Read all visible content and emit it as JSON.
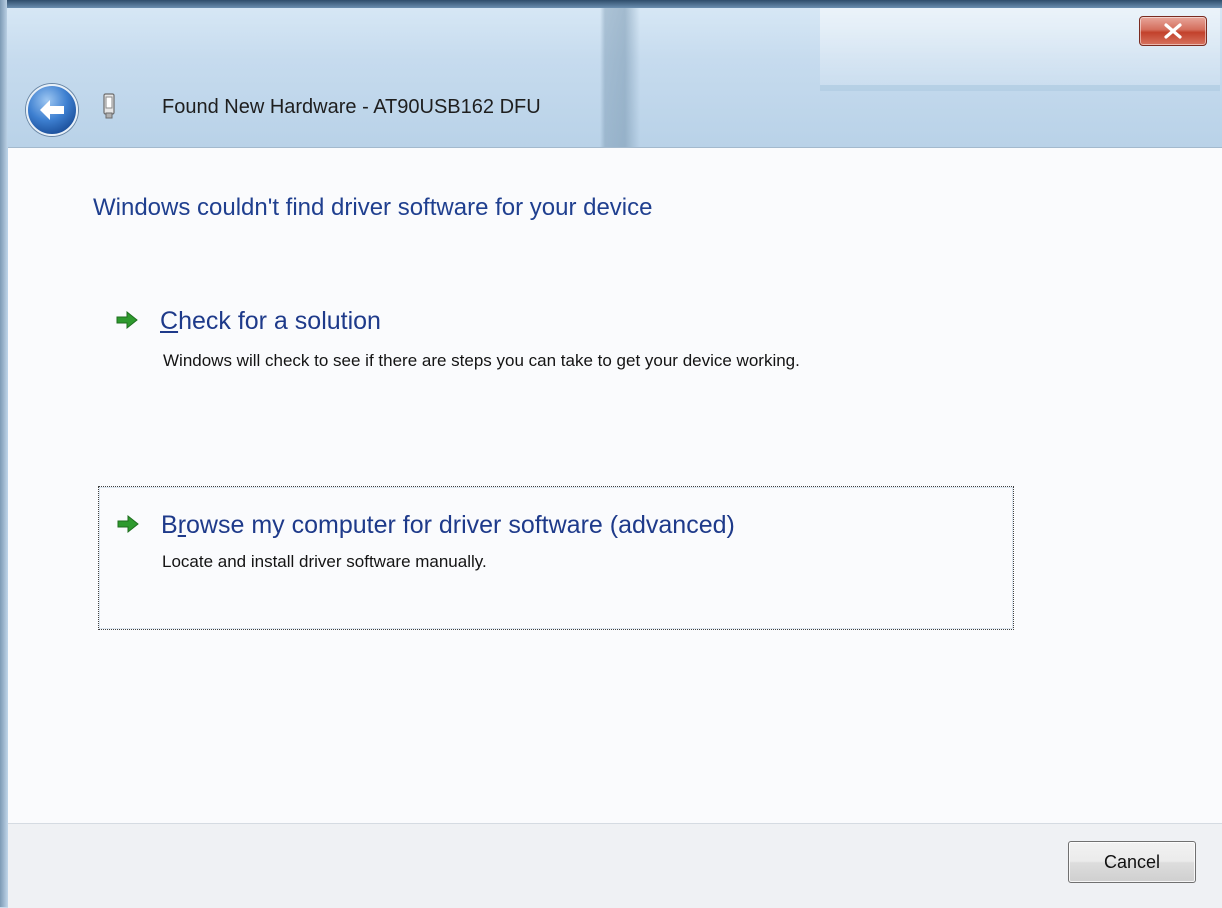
{
  "window": {
    "title": "Found New Hardware - AT90USB162 DFU",
    "close_label": "X"
  },
  "dialog": {
    "heading": "Windows couldn't find driver software for your device",
    "options": [
      {
        "title_accel": "C",
        "title_rest": "heck for a solution",
        "description": "Windows will check to see if there are steps you can take to get your device working."
      },
      {
        "title_pre": "B",
        "title_accel": "r",
        "title_rest": "owse my computer for driver software (advanced)",
        "description": "Locate and install driver software manually."
      }
    ]
  },
  "footer": {
    "cancel_label": "Cancel"
  },
  "colors": {
    "heading": "#1f3f8f",
    "arrow_green": "#2e9a2e",
    "content_bg": "#fafbfd"
  },
  "icons": [
    "close-icon",
    "back-arrow-icon",
    "usb-device-icon",
    "green-arrow-icon"
  ]
}
